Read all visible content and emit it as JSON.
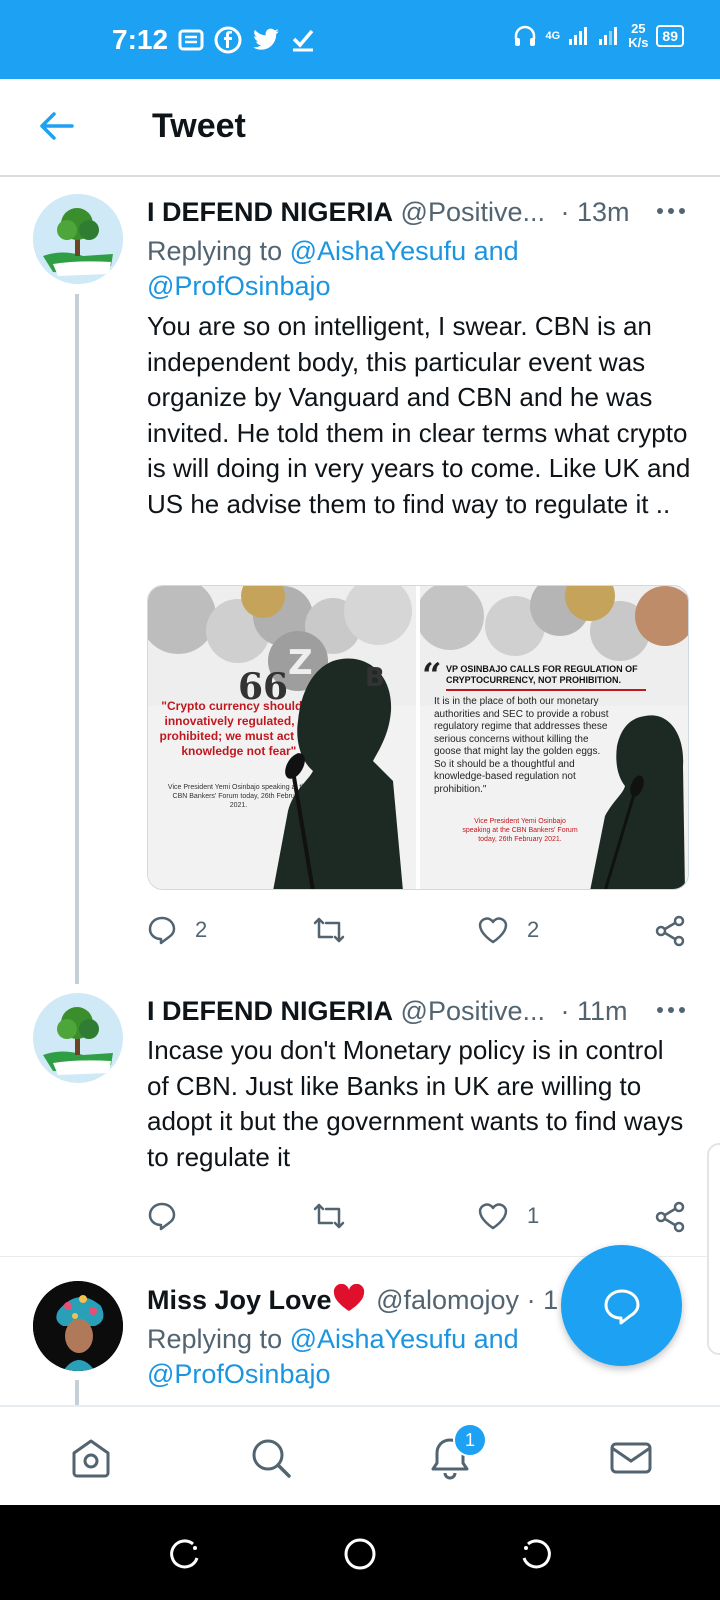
{
  "status": {
    "time": "7:12",
    "net": "4G",
    "speed_value": "25",
    "speed_unit": "K/s",
    "battery": "89"
  },
  "header": {
    "title": "Tweet"
  },
  "tweets": [
    {
      "name": "I DEFEND NIGERIA",
      "handle": "@Positive...",
      "time": "· 13m",
      "reply_prefix": "Replying to",
      "reply_link": "@AishaYesufu and @ProfOsinbajo",
      "text": "You are so on intelligent, I swear. CBN is an independent body, this particular event was organize by Vanguard and CBN and he was invited. He told them in clear terms what crypto is will doing in very years to come. Like UK and US he advise them to find way to regulate it ..",
      "replies": "2",
      "retweets": "",
      "likes": "2"
    },
    {
      "name": "I DEFEND NIGERIA",
      "handle": "@Positive...",
      "time": "· 11m",
      "text": "Incase you don't Monetary policy is in control of CBN. Just like Banks in UK are willing to adopt it but the government wants to find ways to regulate it",
      "replies": "",
      "retweets": "",
      "likes": "1"
    },
    {
      "name": "Miss Joy Love",
      "handle": "@falomojoy",
      "time": "· 1",
      "reply_prefix": "Replying to",
      "reply_link": "@AishaYesufu and @ProfOsinbajo"
    }
  ],
  "media": {
    "left_quote_mark": "66",
    "left_quote": "\"Crypto currency should be innovatively regulated, not prohibited; we must act with knowledge not fear\".",
    "left_caption": "Vice President Yemi Osinbajo speaking at the CBN Bankers' Forum today, 26th February 2021.",
    "right_headline": "VP OSINBAJO CALLS FOR REGULATION OF CRYPTOCURRENCY, NOT PROHIBITION.",
    "right_body": "It is in the place of both our monetary authorities and SEC to provide a robust regulatory regime that addresses these serious concerns without killing the goose that might lay the golden eggs. So it should be a thoughtful and knowledge-based regulation not prohibition.\"",
    "right_caption": "Vice President Yemi Osinbajo speaking at the CBN Bankers' Forum today, 26th February 2021."
  },
  "nav": {
    "notifications_badge": "1"
  },
  "colors": {
    "accent": "#1da1f2",
    "link": "#1b95e0",
    "heart": "#e0245e"
  }
}
